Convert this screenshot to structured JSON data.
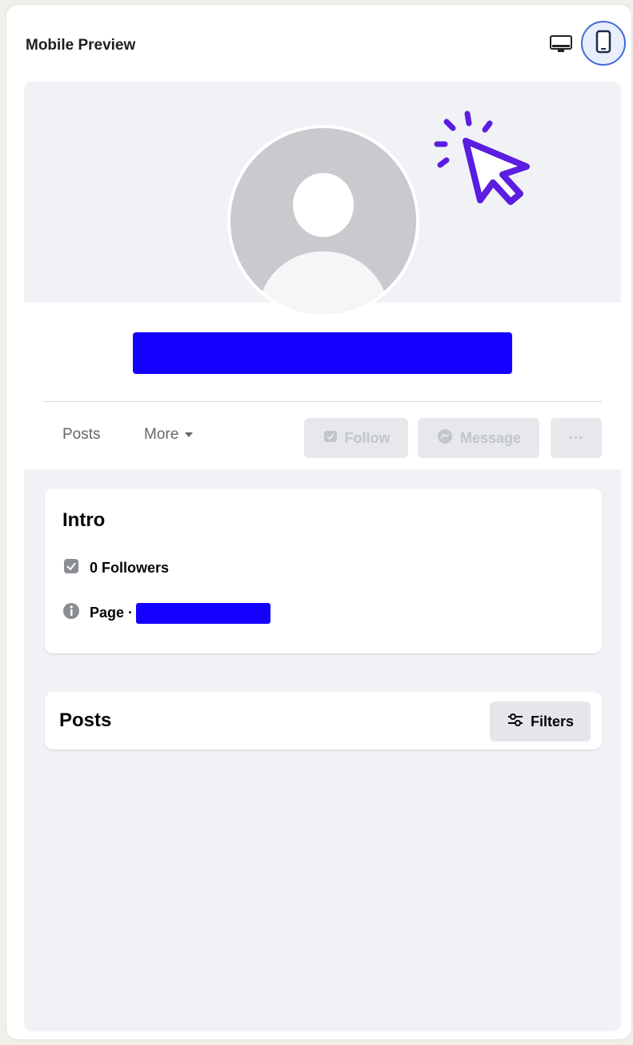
{
  "panel": {
    "title": "Mobile Preview",
    "view_toggles": [
      {
        "name": "desktop",
        "icon": "desktop-icon",
        "active": false
      },
      {
        "name": "mobile",
        "icon": "mobile-icon",
        "active": true
      }
    ]
  },
  "profile": {
    "avatar_icon": "default-avatar-icon",
    "cursor_icon": "click-cursor-icon",
    "redaction_color": "#1400ff"
  },
  "tabs": {
    "posts_label": "Posts",
    "more_label": "More"
  },
  "actions": {
    "follow_label": "Follow",
    "message_label": "Message",
    "more_label": "···"
  },
  "intro": {
    "title": "Intro",
    "followers_text": "0 Followers",
    "page_label": "Page ·"
  },
  "posts_section": {
    "title": "Posts",
    "filters_label": "Filters"
  },
  "colors": {
    "accent_blue": "#3f6ad8",
    "cursor_purple": "#5b1de0",
    "preview_bg": "#f0f2f5"
  }
}
